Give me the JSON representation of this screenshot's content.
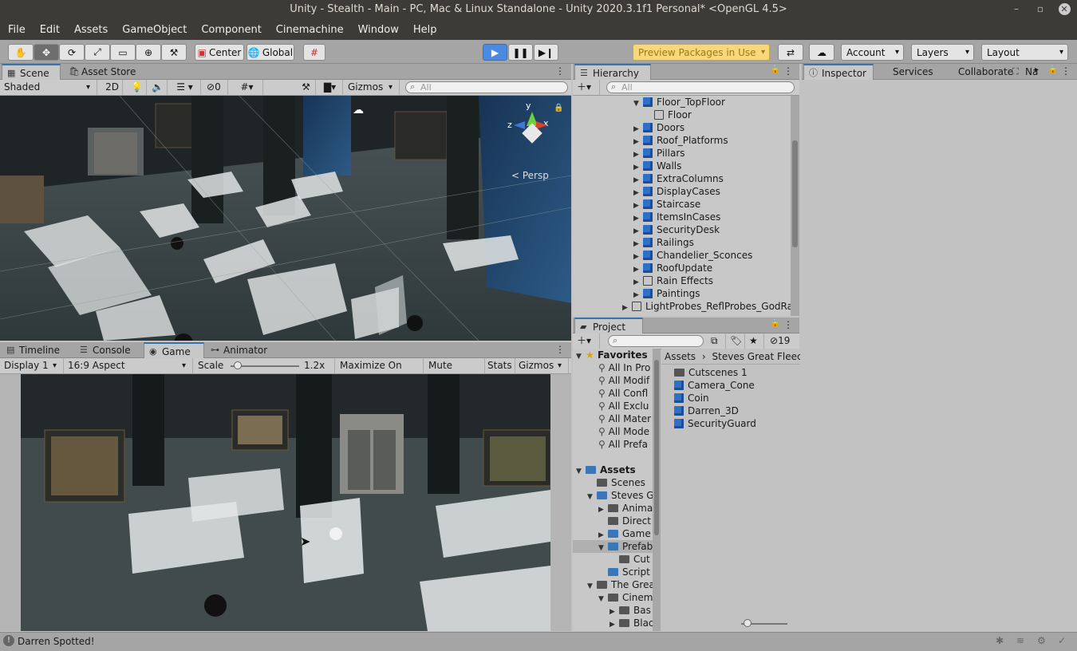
{
  "window": {
    "title": "Unity - Stealth - Main - PC, Mac & Linux Standalone - Unity 2020.3.1f1 Personal* <OpenGL 4.5>"
  },
  "menu": [
    "File",
    "Edit",
    "Assets",
    "GameObject",
    "Component",
    "Cinemachine",
    "Window",
    "Help"
  ],
  "toolbar": {
    "pivot_label": "Center",
    "space_label": "Global",
    "preview_packages_label": "Preview Packages in Use",
    "account_label": "Account",
    "layers_label": "Layers",
    "layout_label": "Layout"
  },
  "scene": {
    "tabs": [
      "Scene",
      "Asset Store"
    ],
    "shading_mode": "Shaded",
    "mode_2d_label": "2D",
    "hidden_count": "0",
    "gizmos_label": "Gizmos",
    "search_placeholder": "All",
    "gizmo_axes": {
      "x": "x",
      "y": "y",
      "z": "z"
    },
    "persp_label": "< Persp"
  },
  "game": {
    "tabs": [
      "Timeline",
      "Console",
      "Game",
      "Animator"
    ],
    "display_label": "Display 1",
    "aspect_label": "16:9 Aspect",
    "scale_label": "Scale",
    "scale_value": "1.2x",
    "scale_level": 0.05,
    "maximize_label": "Maximize On Play",
    "mute_label": "Mute Audio",
    "stats_label": "Stats",
    "gizmos_label": "Gizmos"
  },
  "hierarchy": {
    "title": "Hierarchy",
    "search_placeholder": "All",
    "items": [
      {
        "label": "Floor_TopFloor",
        "expanded": true,
        "indent": 1,
        "icon": "cube"
      },
      {
        "label": "Floor",
        "expanded": null,
        "indent": 2,
        "icon": "cube-hollow"
      },
      {
        "label": "Doors",
        "expanded": false,
        "indent": 1,
        "icon": "cube"
      },
      {
        "label": "Roof_Platforms",
        "expanded": false,
        "indent": 1,
        "icon": "cube"
      },
      {
        "label": "Pillars",
        "expanded": false,
        "indent": 1,
        "icon": "cube"
      },
      {
        "label": "Walls",
        "expanded": false,
        "indent": 1,
        "icon": "cube"
      },
      {
        "label": "ExtraColumns",
        "expanded": false,
        "indent": 1,
        "icon": "cube"
      },
      {
        "label": "DisplayCases",
        "expanded": false,
        "indent": 1,
        "icon": "cube"
      },
      {
        "label": "Staircase",
        "expanded": false,
        "indent": 1,
        "icon": "cube"
      },
      {
        "label": "ItemsInCases",
        "expanded": false,
        "indent": 1,
        "icon": "cube"
      },
      {
        "label": "SecurityDesk",
        "expanded": false,
        "indent": 1,
        "icon": "cube"
      },
      {
        "label": "Railings",
        "expanded": false,
        "indent": 1,
        "icon": "cube"
      },
      {
        "label": "Chandelier_Sconces",
        "expanded": false,
        "indent": 1,
        "icon": "cube"
      },
      {
        "label": "RoofUpdate",
        "expanded": false,
        "indent": 1,
        "icon": "cube"
      },
      {
        "label": "Rain Effects",
        "expanded": false,
        "indent": 1,
        "icon": "cube-hollow"
      },
      {
        "label": "Paintings",
        "expanded": false,
        "indent": 1,
        "icon": "cube"
      },
      {
        "label": "LightProbes_ReflProbes_GodRays",
        "expanded": false,
        "indent": 0,
        "icon": "cube-hollow"
      }
    ]
  },
  "project": {
    "title": "Project",
    "hidden_count": "19",
    "favorites_label": "Favorites",
    "favorites": [
      "All In Pro",
      "All Modif",
      "All Confl",
      "All Exclu",
      "All Mater",
      "All Mode",
      "All Prefa"
    ],
    "tree": [
      {
        "label": "Assets",
        "indent": 0,
        "arrow": "down",
        "icon": "folder-blue",
        "bold": true
      },
      {
        "label": "Scenes",
        "indent": 1,
        "arrow": "",
        "icon": "folder"
      },
      {
        "label": "Steves G",
        "indent": 1,
        "arrow": "down",
        "icon": "folder-blue"
      },
      {
        "label": "Anima",
        "indent": 2,
        "arrow": "right",
        "icon": "folder"
      },
      {
        "label": "Direct",
        "indent": 2,
        "arrow": "",
        "icon": "folder"
      },
      {
        "label": "Game",
        "indent": 2,
        "arrow": "right",
        "icon": "folder-blue"
      },
      {
        "label": "Prefab",
        "indent": 2,
        "arrow": "down",
        "icon": "folder-blue",
        "selected": true
      },
      {
        "label": "Cut",
        "indent": 3,
        "arrow": "",
        "icon": "folder"
      },
      {
        "label": "Script",
        "indent": 2,
        "arrow": "",
        "icon": "folder-blue"
      },
      {
        "label": "The Grea",
        "indent": 1,
        "arrow": "down",
        "icon": "folder"
      },
      {
        "label": "Cinem",
        "indent": 2,
        "arrow": "down",
        "icon": "folder"
      },
      {
        "label": "Bas",
        "indent": 3,
        "arrow": "right",
        "icon": "folder"
      },
      {
        "label": "Blac",
        "indent": 3,
        "arrow": "right",
        "icon": "folder"
      }
    ],
    "breadcrumb": [
      "Assets",
      "Steves Great Fleece"
    ],
    "files": [
      {
        "label": "Cutscenes 1",
        "icon": "folder"
      },
      {
        "label": "Camera_Cone",
        "icon": "prefab"
      },
      {
        "label": "Coin",
        "icon": "prefab"
      },
      {
        "label": "Darren_3D",
        "icon": "prefab"
      },
      {
        "label": "SecurityGuard",
        "icon": "prefab"
      }
    ]
  },
  "inspector": {
    "tabs": [
      "Inspector",
      "Services",
      "Collaborate",
      "Na"
    ]
  },
  "status": {
    "message": "Darren Spotted!"
  },
  "colors": {
    "play_blue": "#4a8ae0",
    "preview_yellow": "#f5c842",
    "selection": "#3a72b0"
  }
}
